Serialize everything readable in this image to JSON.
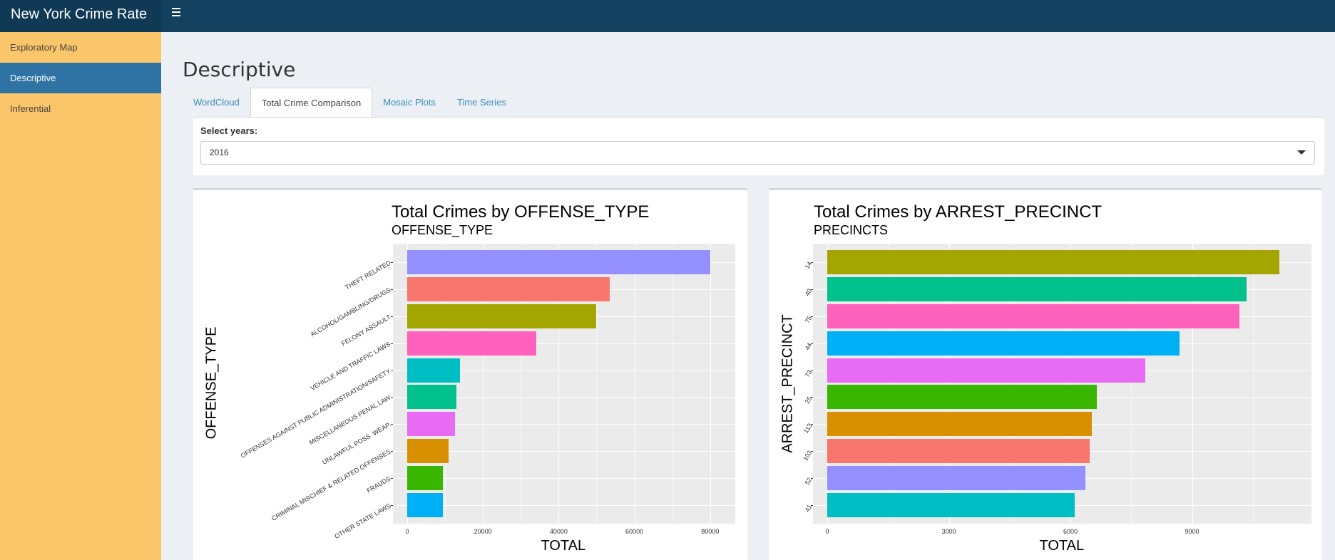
{
  "app": {
    "title": "New York Crime Rate"
  },
  "sidebar": {
    "items": [
      {
        "label": "Exploratory Map",
        "active": false
      },
      {
        "label": "Descriptive",
        "active": true
      },
      {
        "label": "Inferential",
        "active": false
      }
    ]
  },
  "page": {
    "title": "Descriptive"
  },
  "tabs": [
    {
      "label": "WordCloud",
      "active": false
    },
    {
      "label": "Total Crime Comparison",
      "active": true
    },
    {
      "label": "Mosaic Plots",
      "active": false
    },
    {
      "label": "Time Series",
      "active": false
    }
  ],
  "year_select": {
    "label": "Select years:",
    "value": "2016"
  },
  "chart_data": [
    {
      "type": "bar",
      "orientation": "horizontal",
      "title": "Total Crimes by OFFENSE_TYPE",
      "subtitle": "OFFENSE_TYPE",
      "xlabel": "TOTAL",
      "ylabel": "OFFENSE_TYPE",
      "xlim": [
        0,
        84000
      ],
      "xticks": [
        0,
        20000,
        40000,
        60000,
        80000
      ],
      "grid": true,
      "categories": [
        "THEFT RELATED",
        "ALCOHOL/GAMBLING/DRUGS",
        "FELONY ASSAULT",
        "VEHICLE AND TRAFFIC LAWS",
        "OFFENSES AGAINST PUBLIC ADMINISTRATION/SAFETY",
        "MISCELLANEOUS PENAL LAW",
        "UNLAWFUL POSS. WEAP.",
        "CRIMINAL MISCHIEF & RELATED OFFENSES",
        "FRAUDS",
        "OTHER STATE LAWS"
      ],
      "values": [
        80000,
        53500,
        50000,
        34000,
        14000,
        13000,
        12700,
        11000,
        9500,
        9500
      ],
      "colors": [
        "#9590ff",
        "#f8766d",
        "#a3a500",
        "#ff62bc",
        "#00bfc4",
        "#00c08b",
        "#e76bf3",
        "#d89000",
        "#39b600",
        "#00b0f6"
      ]
    },
    {
      "type": "bar",
      "orientation": "horizontal",
      "title": "Total Crimes by ARREST_PRECINCT",
      "subtitle": "PRECINCTS",
      "xlabel": "TOTAL",
      "ylabel": "ARREST_PRECINCT",
      "xlim": [
        0,
        11700
      ],
      "xticks": [
        0,
        3000,
        6000,
        9000
      ],
      "grid": true,
      "categories": [
        "14",
        "40",
        "75",
        "44",
        "73",
        "25",
        "113",
        "103",
        "52",
        "41"
      ],
      "values": [
        11150,
        10350,
        10170,
        8700,
        7850,
        6650,
        6530,
        6480,
        6370,
        6100
      ],
      "colors": [
        "#a3a500",
        "#00c08b",
        "#ff62bc",
        "#00b0f6",
        "#e76bf3",
        "#39b600",
        "#d89000",
        "#f8766d",
        "#9590ff",
        "#00bfc4"
      ]
    }
  ]
}
